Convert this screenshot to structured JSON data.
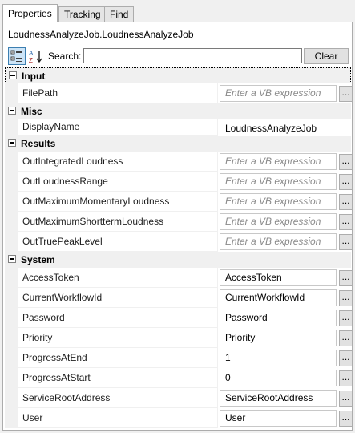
{
  "tabs": [
    "Properties",
    "Tracking",
    "Find"
  ],
  "object_title": "LoudnessAnalyzeJob.LoudnessAnalyzeJob",
  "toolbar": {
    "categorized_icon": "categorized-view-icon",
    "sort_icon": "sort-alphabetical-icon",
    "search_label": "Search:",
    "search_value": "",
    "clear_label": "Clear"
  },
  "ellipsis_label": "...",
  "categories": {
    "input": {
      "name": "Input",
      "rows": [
        {
          "name": "FilePath",
          "value": "Enter a VB expression"
        }
      ]
    },
    "misc": {
      "name": "Misc",
      "rows": [
        {
          "name": "DisplayName",
          "value": "LoudnessAnalyzeJob"
        }
      ]
    },
    "results": {
      "name": "Results",
      "rows": [
        {
          "name": "OutIntegratedLoudness",
          "value": "Enter a VB expression"
        },
        {
          "name": "OutLoudnessRange",
          "value": "Enter a VB expression"
        },
        {
          "name": "OutMaximumMomentaryLoudness",
          "value": "Enter a VB expression"
        },
        {
          "name": "OutMaximumShorttermLoudness",
          "value": "Enter a VB expression"
        },
        {
          "name": "OutTruePeakLevel",
          "value": "Enter a VB expression"
        }
      ]
    },
    "system": {
      "name": "System",
      "rows": [
        {
          "name": "AccessToken",
          "value": "AccessToken"
        },
        {
          "name": "CurrentWorkflowId",
          "value": "CurrentWorkflowId"
        },
        {
          "name": "Password",
          "value": "Password"
        },
        {
          "name": "Priority",
          "value": "Priority"
        },
        {
          "name": "ProgressAtEnd",
          "value": "1"
        },
        {
          "name": "ProgressAtStart",
          "value": "0"
        },
        {
          "name": "ServiceRootAddress",
          "value": "ServiceRootAddress"
        },
        {
          "name": "User",
          "value": "User"
        }
      ]
    }
  }
}
